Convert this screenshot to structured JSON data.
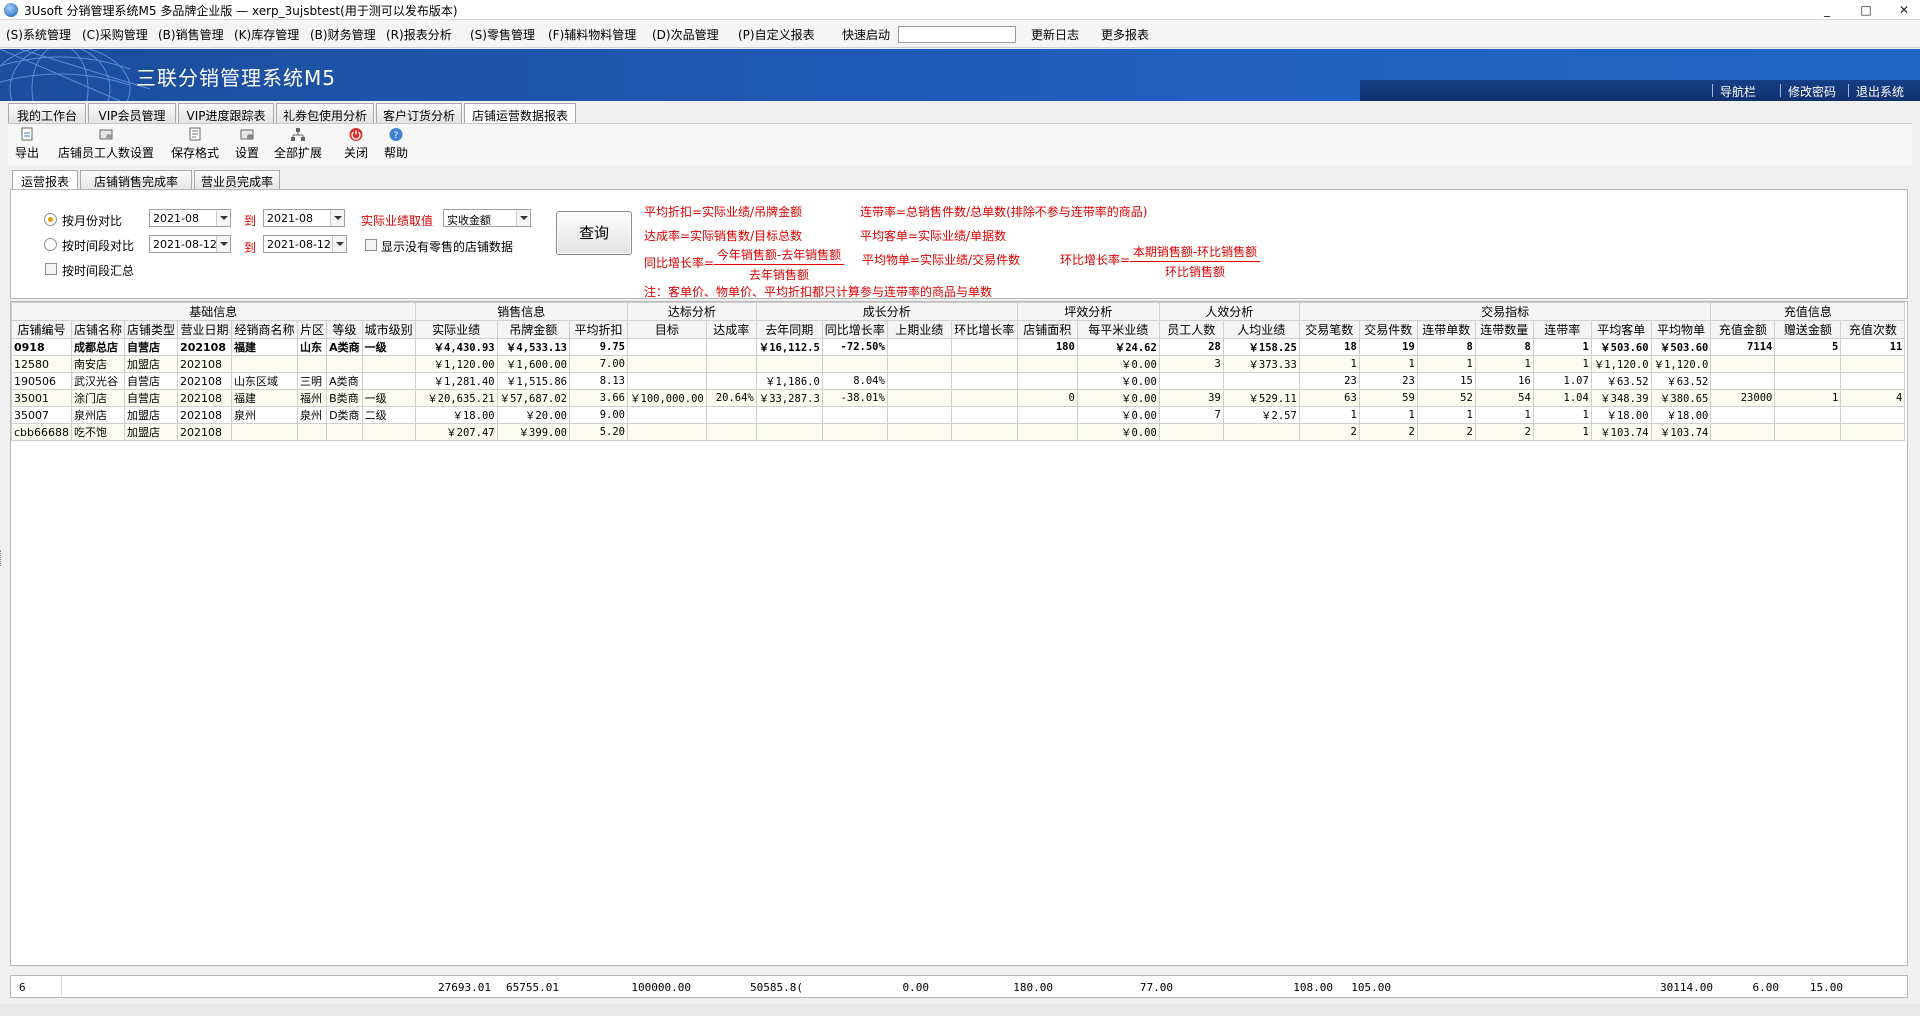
{
  "window": {
    "title": "3Usoft 分销管理系统M5 多品牌企业版 — xerp_3ujsbtest(用于测可以发布版本)",
    "min": "_",
    "max": "□",
    "close": "✕"
  },
  "menu": {
    "items": [
      "(S)系统管理",
      "(C)采购管理",
      "(B)销售管理",
      "(K)库存管理",
      "(B)财务管理",
      "(R)报表分析",
      "(S)零售管理",
      "(F)辅料物料管理",
      "(D)次品管理",
      "(P)自定义报表"
    ],
    "quick_label": "快速启动",
    "quick_value": "",
    "update_log": "更新日志",
    "more_reports": "更多报表"
  },
  "banner": {
    "brand": "三联分销管理系统M5",
    "nav": "导航栏",
    "change_pwd": "修改密码",
    "logout": "退出系统"
  },
  "main_tabs": [
    "我的工作台",
    "VIP会员管理",
    "VIP进度跟踪表",
    "礼券包使用分析",
    "客户订货分析",
    "店铺运营数据报表"
  ],
  "toolbar": [
    "导出",
    "店铺员工人数设置",
    "保存格式",
    "设置",
    "全部扩展",
    "关闭",
    "帮助"
  ],
  "sub_tabs": [
    "运营报表",
    "店铺销售完成率",
    "营业员完成率"
  ],
  "query": {
    "by_month": "按月份对比",
    "by_period": "按时间段对比",
    "by_period_sum": "按时间段汇总",
    "month_from": "2021-08",
    "month_to": "2021-08",
    "date_from": "2021-08-12",
    "date_to": "2021-08-12",
    "to": "到",
    "to2": "到",
    "actual_label": "实际业绩取值",
    "actual_value": "实收金额",
    "show_no_sales": "显示没有零售的店铺数据",
    "query_btn": "查询"
  },
  "formulas": {
    "f1": "平均折扣=实际业绩/吊牌金额",
    "f2": "连带率=总销售件数/总单数(排除不参与连带率的商品)",
    "f3": "达成率=实际销售数/目标总数",
    "f4": "平均客单=实际业绩/单据数",
    "f5_label": "同比增长率=",
    "f5_num": "今年销售额-去年销售额",
    "f5_den": "去年销售额",
    "f6": "平均物单=实际业绩/交易件数",
    "f7_label": "环比增长率=",
    "f7_num": "本期销售额-环比销售额",
    "f7_den": "环比销售额",
    "note": "注：客单价、物单价、平均折扣都只计算参与连带率的商品与单数"
  },
  "grid": {
    "groups": [
      "基础信息",
      "销售信息",
      "达标分析",
      "成长分析",
      "坪效分析",
      "人效分析",
      "交易指标",
      "充值信息"
    ],
    "columns": [
      "店铺编号",
      "店铺名称",
      "店铺类型",
      "营业日期",
      "经销商名称",
      "片区",
      "等级",
      "城市级别",
      "实际业绩",
      "吊牌金额",
      "平均折扣",
      "目标",
      "达成率",
      "去年同期",
      "同比增长率",
      "上期业绩",
      "环比增长率",
      "店铺面积",
      "每平米业绩",
      "员工人数",
      "人均业绩",
      "交易笔数",
      "交易件数",
      "连带单数",
      "连带数量",
      "连带率",
      "平均客单",
      "平均物单",
      "充值金额",
      "赠送金额",
      "充值次数"
    ],
    "rows": [
      [
        "0918",
        "成都总店",
        "自营店",
        "202108",
        "福建",
        "山东",
        "A类商",
        "一级",
        "￥4,430.93",
        "￥4,533.13",
        "9.75",
        "",
        "",
        "￥16,112.5",
        "-72.50%",
        "",
        "",
        "180",
        "￥24.62",
        "28",
        "￥158.25",
        "18",
        "19",
        "8",
        "8",
        "1",
        "￥503.60",
        "￥503.60",
        "7114",
        "5",
        "11"
      ],
      [
        "12580",
        "南安店",
        "加盟店",
        "202108",
        "",
        "",
        "",
        "",
        "￥1,120.00",
        "￥1,600.00",
        "7.00",
        "",
        "",
        "",
        "",
        "",
        "",
        "",
        "￥0.00",
        "3",
        "￥373.33",
        "1",
        "1",
        "1",
        "1",
        "1",
        "￥1,120.0",
        "￥1,120.0",
        "",
        "",
        ""
      ],
      [
        "190506",
        "武汉光谷",
        "自营店",
        "202108",
        "山东区域",
        "三明",
        "A类商",
        "",
        "￥1,281.40",
        "￥1,515.86",
        "8.13",
        "",
        "",
        "￥1,186.0",
        "8.04%",
        "",
        "",
        "",
        "￥0.00",
        "",
        "",
        "23",
        "23",
        "15",
        "16",
        "1.07",
        "￥63.52",
        "￥63.52",
        "",
        "",
        ""
      ],
      [
        "35001",
        "涂门店",
        "自营店",
        "202108",
        "福建",
        "福州",
        "B类商",
        "一级",
        "￥20,635.21",
        "￥57,687.02",
        "3.66",
        "￥100,000.00",
        "20.64%",
        "￥33,287.3",
        "-38.01%",
        "",
        "",
        "0",
        "￥0.00",
        "39",
        "￥529.11",
        "63",
        "59",
        "52",
        "54",
        "1.04",
        "￥348.39",
        "￥380.65",
        "23000",
        "1",
        "4"
      ],
      [
        "35007",
        "泉州店",
        "加盟店",
        "202108",
        "泉州",
        "泉州",
        "D类商",
        "二级",
        "￥18.00",
        "￥20.00",
        "9.00",
        "",
        "",
        "",
        "",
        "",
        "",
        "",
        "￥0.00",
        "7",
        "￥2.57",
        "1",
        "1",
        "1",
        "1",
        "1",
        "￥18.00",
        "￥18.00",
        "",
        "",
        ""
      ],
      [
        "cbb66688",
        "吃不饱",
        "加盟店",
        "202108",
        "",
        "",
        "",
        "",
        "￥207.47",
        "￥399.00",
        "5.20",
        "",
        "",
        "",
        "",
        "",
        "",
        "",
        "￥0.00",
        "",
        "",
        "2",
        "2",
        "2",
        "2",
        "1",
        "￥103.74",
        "￥103.74",
        "",
        "",
        ""
      ]
    ]
  },
  "footer": {
    "count": "6",
    "actual": "27693.01",
    "tag": "65755.01",
    "target": "100000.00",
    "last_year": "50585.8(",
    "last_period": "0.00",
    "area": "180.00",
    "staff": "77.00",
    "trans": "108.00",
    "items": "105.00",
    "recharge": "30114.00",
    "gift": "6.00",
    "recharge_cnt": "15.00"
  }
}
